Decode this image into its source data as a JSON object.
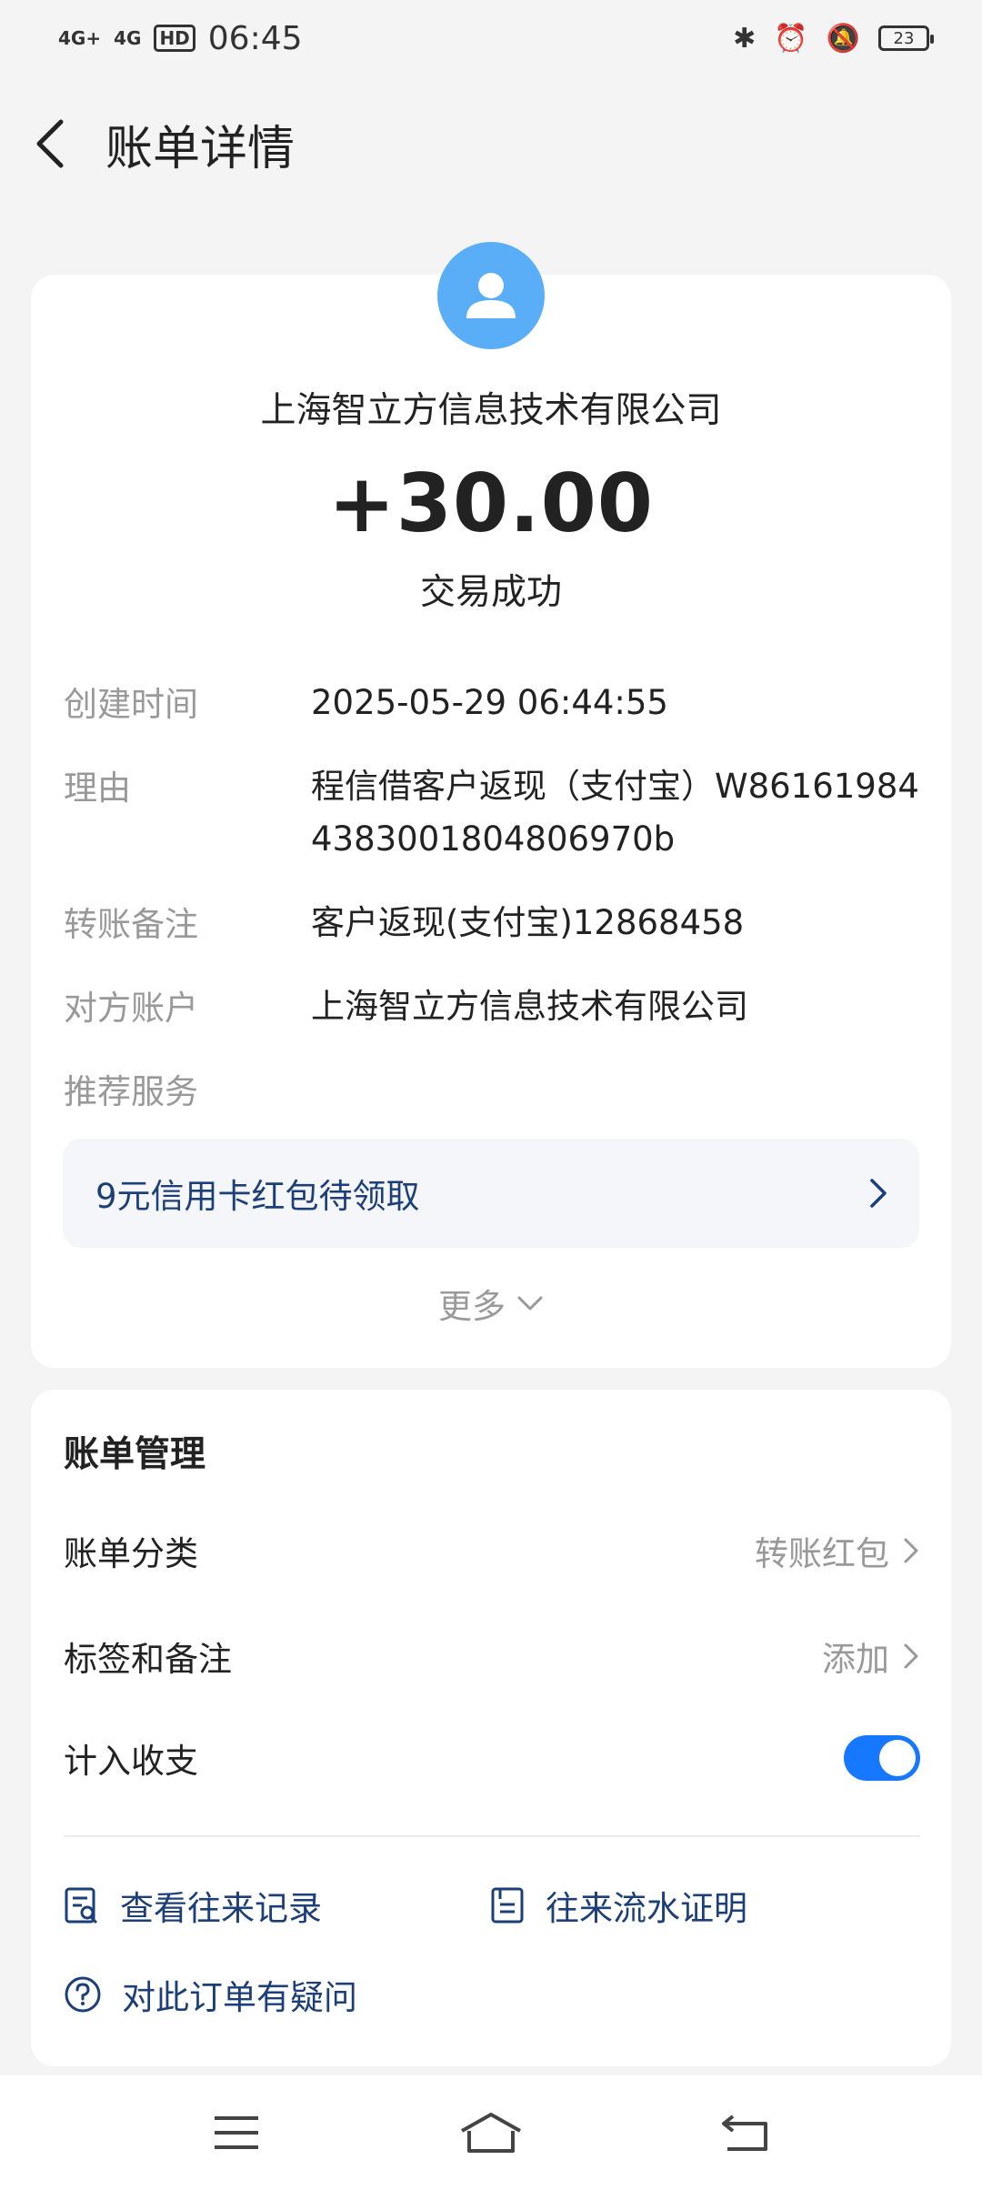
{
  "status_bar": {
    "signal_1": "4G+",
    "signal_2": "4G",
    "hd_label": "HD",
    "time": "06:45",
    "battery": "23"
  },
  "header": {
    "title": "账单详情"
  },
  "transaction": {
    "payee": "上海智立方信息技术有限公司",
    "amount": "+30.00",
    "status": "交易成功"
  },
  "details": [
    {
      "label": "创建时间",
      "value": "2025-05-29 06:44:55"
    },
    {
      "label": "理由",
      "value": "程信借客户返现（支付宝）W861619844383001804806970b"
    },
    {
      "label": "转账备注",
      "value": "客户返现(支付宝)12868458"
    },
    {
      "label": "对方账户",
      "value": "上海智立方信息技术有限公司"
    },
    {
      "label": "推荐服务",
      "value": ""
    }
  ],
  "promo": {
    "text": "9元信用卡红包待领取"
  },
  "more_label": "更多",
  "management": {
    "title": "账单管理",
    "category_label": "账单分类",
    "category_value": "转账红包",
    "tags_label": "标签和备注",
    "tags_value": "添加",
    "include_label": "计入收支",
    "include_enabled": true
  },
  "links": {
    "records": "查看往来记录",
    "statement": "往来流水证明",
    "question": "对此订单有疑问"
  },
  "colors": {
    "accent": "#1677ff",
    "link": "#1d3f79",
    "avatar": "#5aaef8"
  }
}
